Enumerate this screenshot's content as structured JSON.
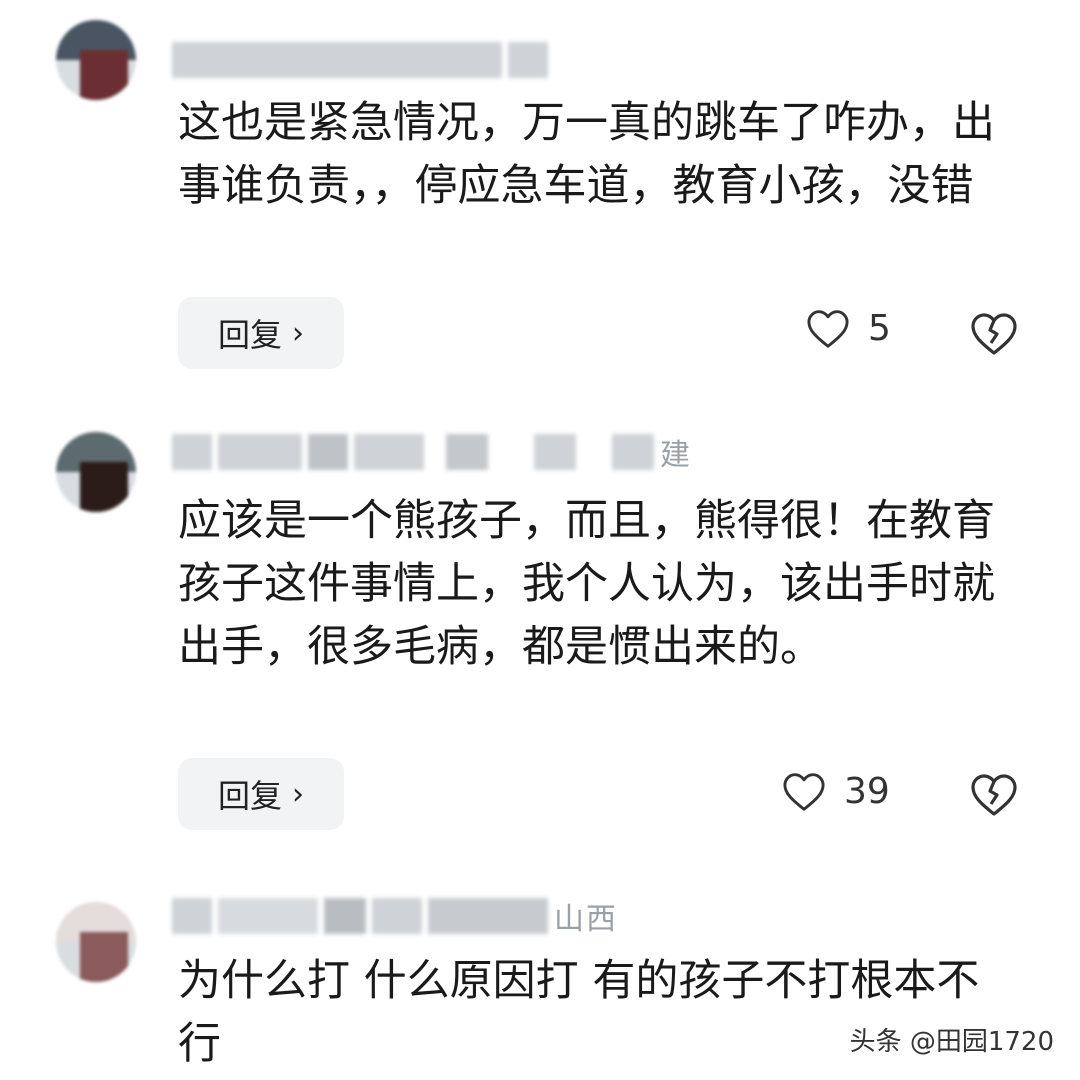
{
  "comments": [
    {
      "username": "",
      "text": "这也是紧急情况，万一真的跳车了咋办，出事谁负责，，停应急车道，教育小孩，没错",
      "reply_label": "回复",
      "like_count": "5"
    },
    {
      "username": "建",
      "text": "应该是一个熊孩子，而且，熊得很！在教育孩子这件事情上，我个人认为，该出手时就出手，很多毛病，都是惯出来的。",
      "reply_label": "回复",
      "like_count": "39"
    },
    {
      "username": "山西",
      "text": "为什么打 什么原因打 有的孩子不打根本不行",
      "reply_label": "",
      "like_count": ""
    }
  ],
  "watermark": "头条 @田园1720",
  "icons": {
    "like": "heart-outline-icon",
    "dislike": "broken-heart-icon",
    "reply": "chevron-right-icon"
  }
}
